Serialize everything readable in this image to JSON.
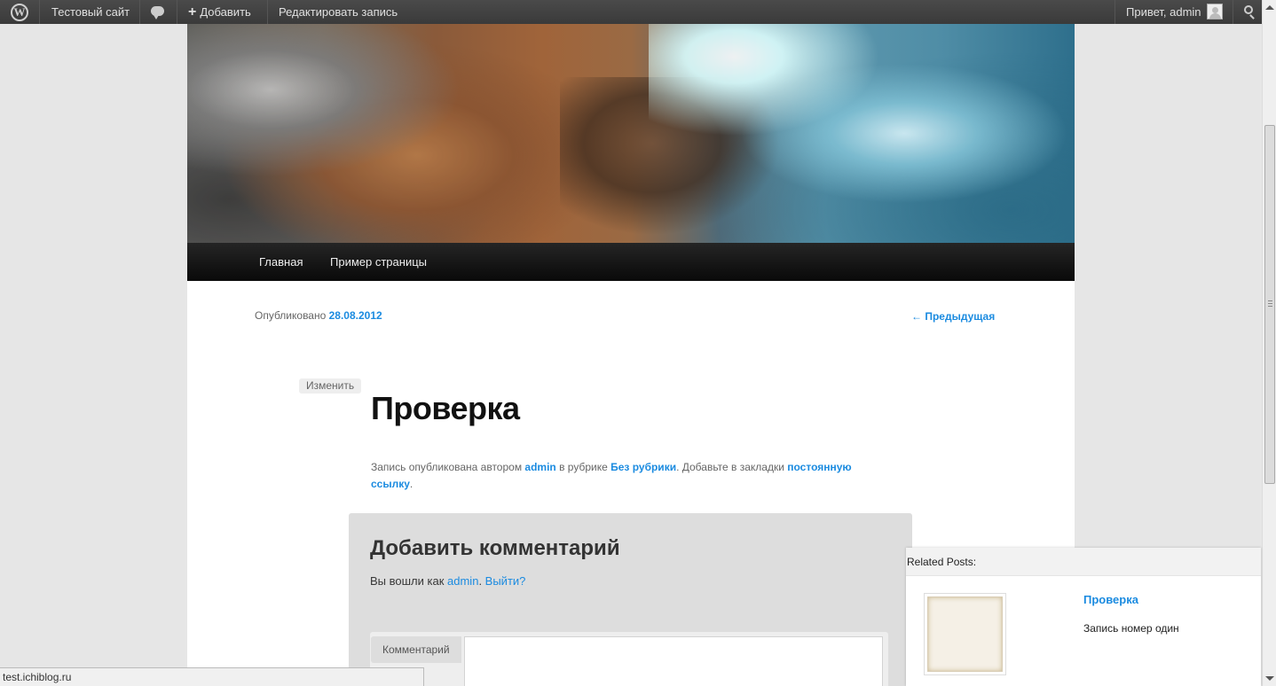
{
  "adminbar": {
    "site_name": "Тестовый сайт",
    "new_label": "Добавить",
    "new_plus": "+",
    "edit_post_label": "Редактировать запись",
    "howdy": "Привет, admin"
  },
  "nav": {
    "items": [
      {
        "label": "Главная"
      },
      {
        "label": "Пример страницы"
      }
    ]
  },
  "post": {
    "published_prefix": "Опубликовано",
    "published_date": "28.08.2012",
    "prev_link": "← Предыдущая",
    "edit_button": "Изменить",
    "title": "Проверка",
    "footer": {
      "part1": "Запись опубликована автором ",
      "author": "admin",
      "part2": " в рубрике ",
      "category": "Без рубрики",
      "part3": ". Добавьте в закладки ",
      "permalink": "постоянную ссылку",
      "part4": "."
    }
  },
  "comments": {
    "title": "Добавить комментарий",
    "logged_in_prefix": "Вы вошли как ",
    "logged_in_user": "admin",
    "logout": "Выйти?",
    "comment_label": "Комментарий"
  },
  "related_posts": {
    "heading": "Related Posts:",
    "items": [
      {
        "title": "Проверка",
        "excerpt": "Запись номер один"
      }
    ]
  },
  "statusbar": {
    "url": "test.ichiblog.ru"
  },
  "colors": {
    "link": "#1b8be0",
    "adminbar_bg": "#464646"
  },
  "icons": {
    "wp_logo": "wordpress-logo-icon",
    "comments": "comment-bubble-icon",
    "search": "search-icon",
    "avatar": "user-avatar-icon"
  }
}
